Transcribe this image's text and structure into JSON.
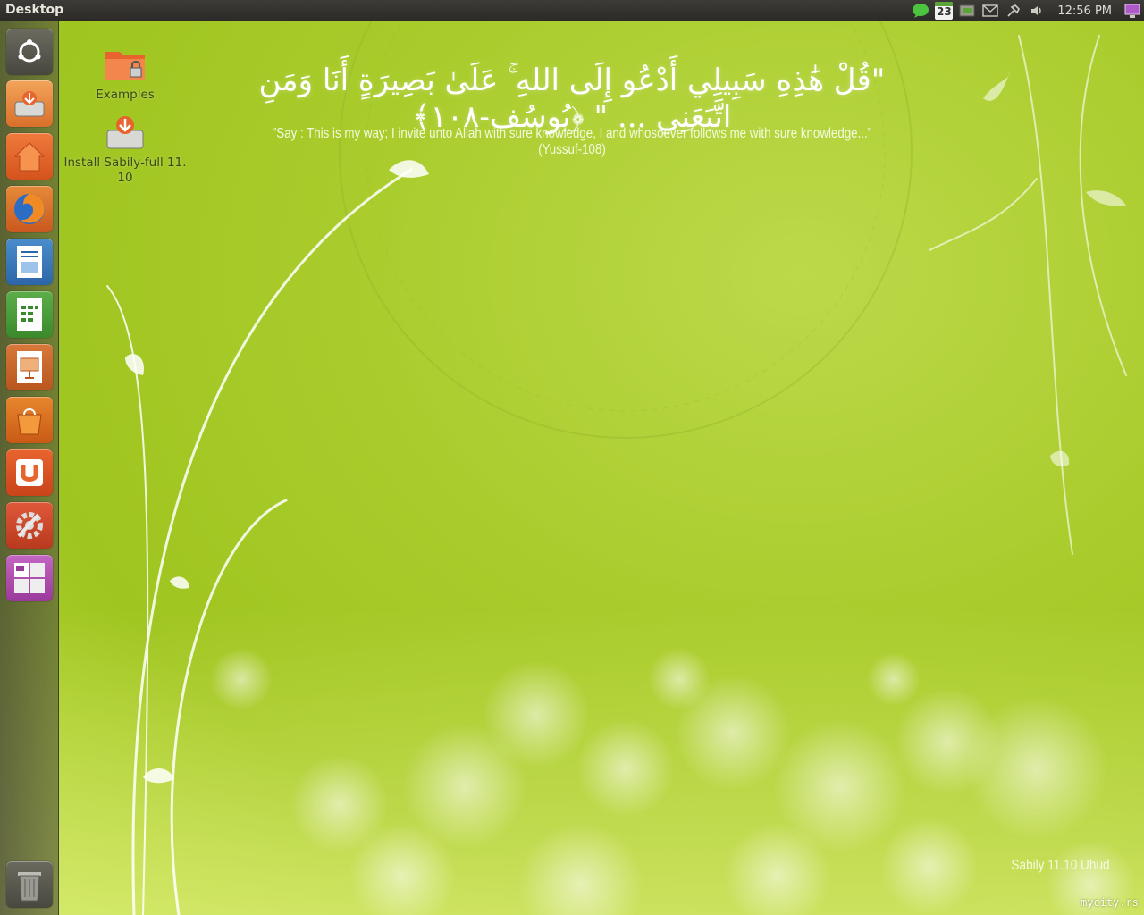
{
  "panel": {
    "title": "Desktop",
    "clock": "12:56 PM",
    "calendar_day": "23",
    "tray_icons": [
      "chat-icon",
      "calendar-icon",
      "network-icon",
      "mail-icon",
      "pin-icon",
      "volume-icon",
      "session-icon"
    ]
  },
  "launcher": {
    "items": [
      {
        "name": "dash-home",
        "icon": "ubuntu-logo-icon"
      },
      {
        "name": "install-sabily",
        "icon": "installer-icon"
      },
      {
        "name": "home-folder",
        "icon": "home-icon"
      },
      {
        "name": "firefox",
        "icon": "firefox-icon"
      },
      {
        "name": "libreoffice-writer",
        "icon": "writer-icon"
      },
      {
        "name": "libreoffice-calc",
        "icon": "calc-icon"
      },
      {
        "name": "libreoffice-impress",
        "icon": "impress-icon"
      },
      {
        "name": "software-center",
        "icon": "shopping-bag-icon"
      },
      {
        "name": "ubuntu-one",
        "icon": "ubuntu-one-icon"
      },
      {
        "name": "system-settings",
        "icon": "settings-icon"
      },
      {
        "name": "workspace-switcher",
        "icon": "workspaces-icon"
      }
    ],
    "trash_icon": "trash-icon"
  },
  "desktop_icons": [
    {
      "label": "Examples",
      "icon": "folder-icon"
    },
    {
      "label_line1": "Install Sabily-full 11.",
      "label_line2": "10",
      "icon": "installer-icon"
    }
  ],
  "wallpaper": {
    "arabic": "\"قُلْ هَٰذِهِ سَبِيلِي أَدْعُو إِلَى اللهِ ۚ عَلَىٰ بَصِيرَةٍ أَنَا وَمَنِ اتَّبَعَنِي ... \" ﴿يُوسُف-١٠٨﴾",
    "translation": "\"Say : This is my way; I invite unto Allah with sure knowledge, I and whosoever follows me with sure knowledge...\"(Yussuf-108)",
    "brand": "Sabily 11.10 Uhud",
    "watermark": "mycity.rs"
  },
  "colors": {
    "wallpaper_green": "#a9cc2c",
    "panel_dark": "#3c3b37",
    "launcher_tint": "#5a5a3c",
    "orange": "#e8642e"
  }
}
